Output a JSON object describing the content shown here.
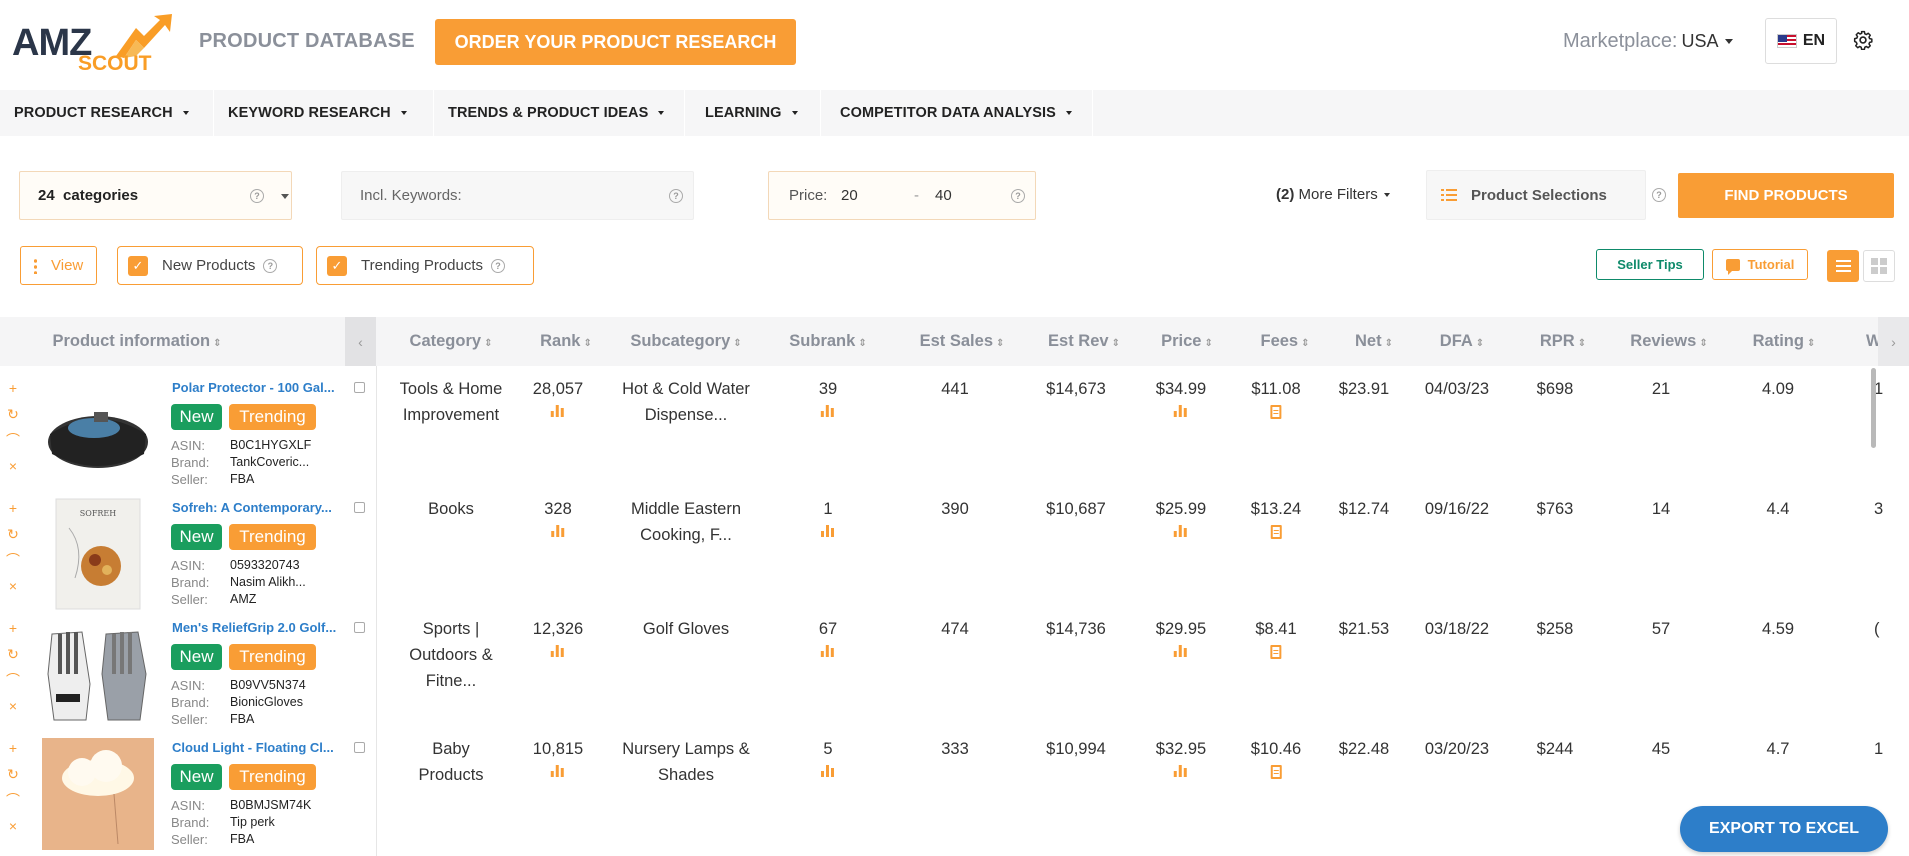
{
  "header": {
    "logo_top": "AMZ",
    "logo_bottom": "SCOUT",
    "page_title": "PRODUCT DATABASE",
    "order_button": "ORDER YOUR PRODUCT RESEARCH",
    "marketplace_label": "Marketplace:",
    "marketplace_value": "USA",
    "language": "EN"
  },
  "nav": {
    "items": [
      {
        "label": "PRODUCT RESEARCH"
      },
      {
        "label": "KEYWORD RESEARCH"
      },
      {
        "label": "TRENDS & PRODUCT IDEAS"
      },
      {
        "label": "LEARNING"
      },
      {
        "label": "COMPETITOR DATA ANALYSIS"
      }
    ]
  },
  "filters": {
    "categories_count": "24",
    "categories_label": "categories",
    "keywords_placeholder": "Incl. Keywords:",
    "price_label": "Price:",
    "price_min": "20",
    "price_max": "40",
    "more_filters_count": "(2)",
    "more_filters_label": "More Filters",
    "product_selections": "Product Selections",
    "find_button": "FIND PRODUCTS",
    "view_button": "View",
    "new_products": "New Products",
    "trending_products": "Trending Products",
    "seller_tips": "Seller Tips",
    "tutorial": "Tutorial"
  },
  "table": {
    "headers": [
      "Product information",
      "Category",
      "Rank",
      "Subcategory",
      "Subrank",
      "Est Sales",
      "Est Rev",
      "Price",
      "Fees",
      "Net",
      "DFA",
      "RPR",
      "Reviews",
      "Rating",
      "W"
    ],
    "rows": [
      {
        "name": "Polar Protector - 100 Gal...",
        "badge_new": "New",
        "badge_trending": "Trending",
        "asin_label": "ASIN:",
        "asin": "B0C1HYGXLF",
        "brand_label": "Brand:",
        "brand": "TankCoveric...",
        "seller_label": "Seller:",
        "seller": "FBA",
        "category": [
          "Tools & Home",
          "Improvement"
        ],
        "rank": "28,057",
        "subcategory": [
          "Hot & Cold Water",
          "Dispense..."
        ],
        "subrank": "39",
        "est_sales": "441",
        "est_rev": "$14,673",
        "price": "$34.99",
        "fees": "$11.08",
        "net": "$23.91",
        "dfa": "04/03/23",
        "rpr": "$698",
        "reviews": "21",
        "rating": "4.09",
        "w": "1"
      },
      {
        "name": "Sofreh: A Contemporary...",
        "badge_new": "New",
        "badge_trending": "Trending",
        "asin_label": "ASIN:",
        "asin": "0593320743",
        "brand_label": "Brand:",
        "brand": "Nasim Alikh...",
        "seller_label": "Seller:",
        "seller": "AMZ",
        "category": [
          "Books"
        ],
        "rank": "328",
        "subcategory": [
          "Middle Eastern",
          "Cooking, F..."
        ],
        "subrank": "1",
        "est_sales": "390",
        "est_rev": "$10,687",
        "price": "$25.99",
        "fees": "$13.24",
        "net": "$12.74",
        "dfa": "09/16/22",
        "rpr": "$763",
        "reviews": "14",
        "rating": "4.4",
        "w": "3"
      },
      {
        "name": "Men's ReliefGrip 2.0 Golf...",
        "badge_new": "New",
        "badge_trending": "Trending",
        "asin_label": "ASIN:",
        "asin": "B09VV5N374",
        "brand_label": "Brand:",
        "brand": "BionicGloves",
        "seller_label": "Seller:",
        "seller": "FBA",
        "category": [
          "Sports |",
          "Outdoors &",
          "Fitne..."
        ],
        "rank": "12,326",
        "subcategory": [
          "Golf Gloves"
        ],
        "subrank": "67",
        "est_sales": "474",
        "est_rev": "$14,736",
        "price": "$29.95",
        "fees": "$8.41",
        "net": "$21.53",
        "dfa": "03/18/22",
        "rpr": "$258",
        "reviews": "57",
        "rating": "4.59",
        "w": "("
      },
      {
        "name": "Cloud Light - Floating Cl...",
        "badge_new": "New",
        "badge_trending": "Trending",
        "asin_label": "ASIN:",
        "asin": "B0BMJSM74K",
        "brand_label": "Brand:",
        "brand": "Tip perk",
        "seller_label": "Seller:",
        "seller": "FBA",
        "category": [
          "Baby",
          "Products"
        ],
        "rank": "10,815",
        "subcategory": [
          "Nursery Lamps &",
          "Shades"
        ],
        "subrank": "5",
        "est_sales": "333",
        "est_rev": "$10,994",
        "price": "$32.95",
        "fees": "$10.46",
        "net": "$22.48",
        "dfa": "03/20/23",
        "rpr": "$244",
        "reviews": "45",
        "rating": "4.7",
        "w": "1"
      }
    ]
  },
  "export_button": "EXPORT TO EXCEL",
  "colors": {
    "accent": "#f99d35",
    "new_badge": "#1a9e5e",
    "link": "#2d7ec9",
    "seller_tips": "#0e8a6a"
  }
}
